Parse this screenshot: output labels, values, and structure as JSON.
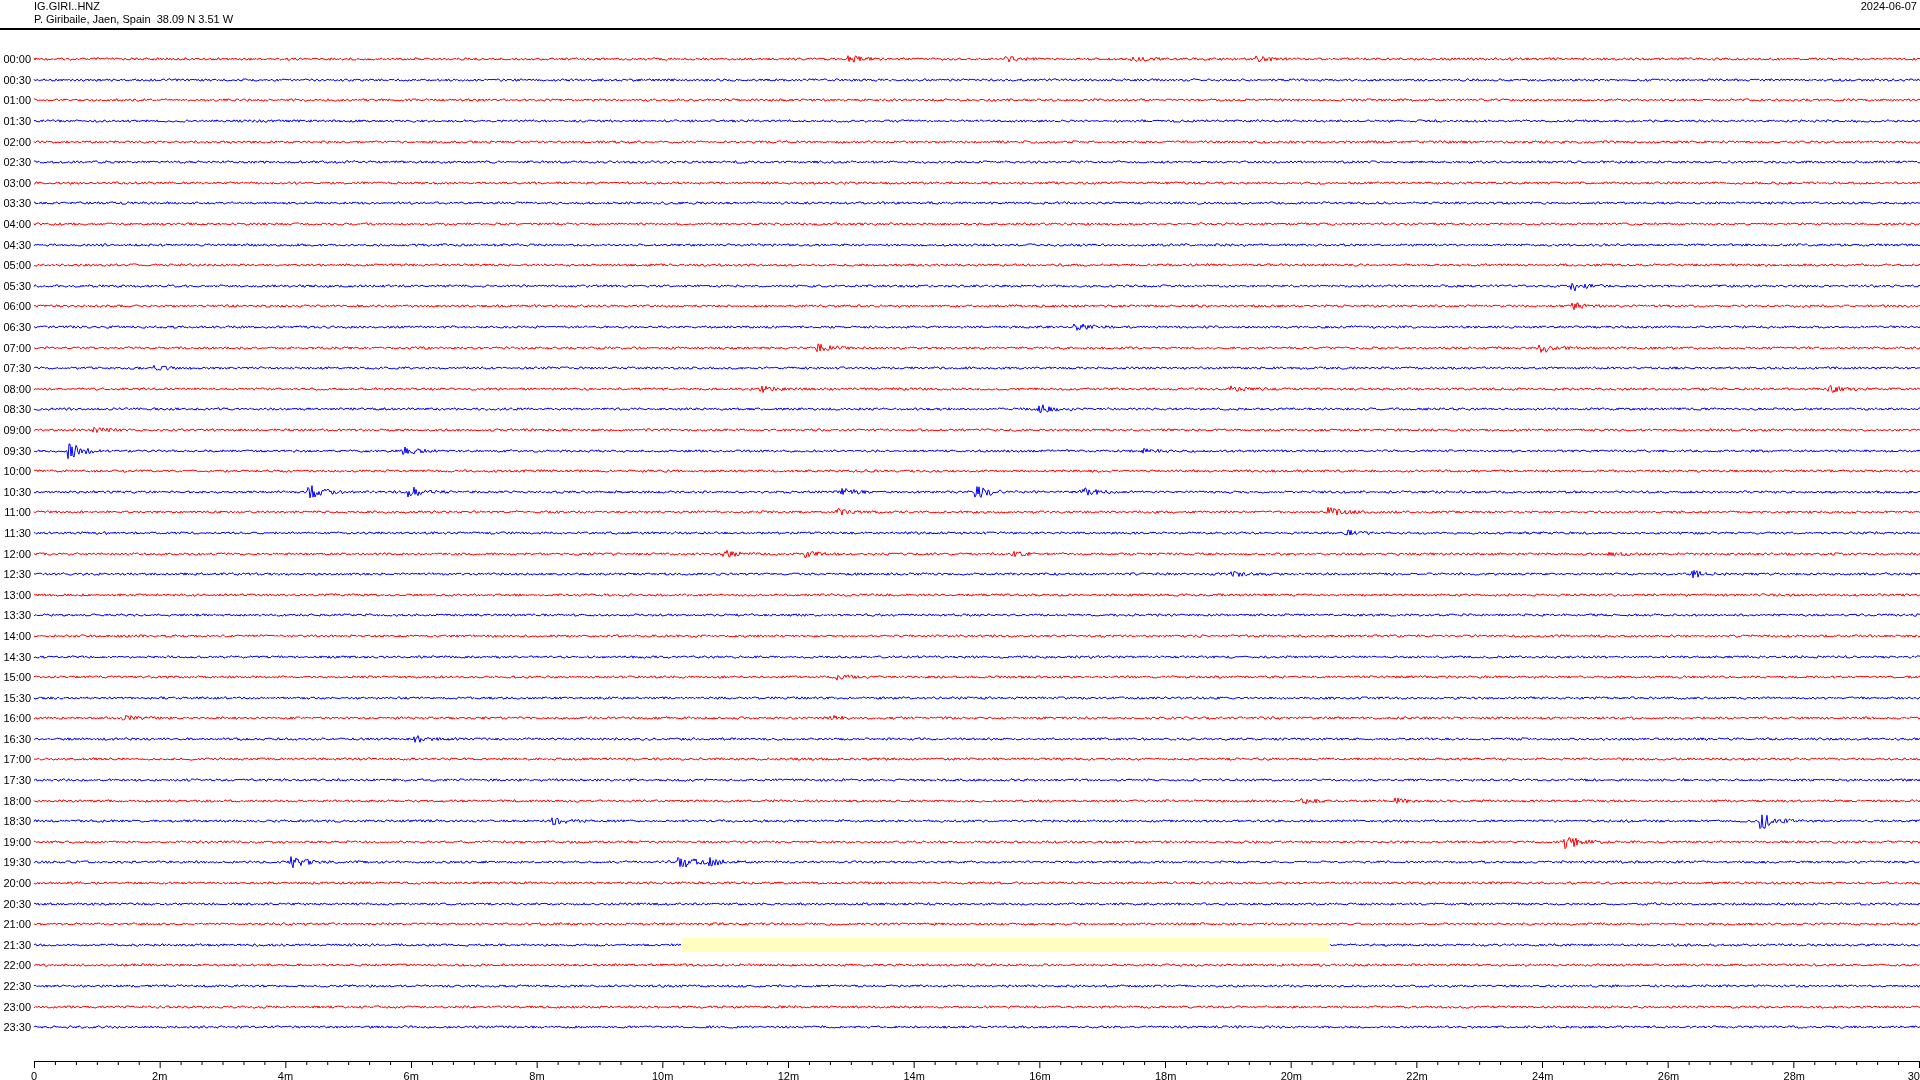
{
  "header": {
    "station": "IG.GIRI..HNZ",
    "location": "P. Giribaile, Jaen, Spain  38.09 N 3.51 W",
    "date": "2024-06-07"
  },
  "rows": [
    {
      "time": "00:00",
      "color": "#ff0000"
    },
    {
      "time": "00:30",
      "color": "#0000ff"
    },
    {
      "time": "01:00",
      "color": "#ff0000"
    },
    {
      "time": "01:30",
      "color": "#0000ff"
    },
    {
      "time": "02:00",
      "color": "#ff0000"
    },
    {
      "time": "02:30",
      "color": "#0000ff"
    },
    {
      "time": "03:00",
      "color": "#ff0000"
    },
    {
      "time": "03:30",
      "color": "#0000ff"
    },
    {
      "time": "04:00",
      "color": "#ff0000"
    },
    {
      "time": "04:30",
      "color": "#0000ff"
    },
    {
      "time": "05:00",
      "color": "#ff0000"
    },
    {
      "time": "05:30",
      "color": "#0000ff"
    },
    {
      "time": "06:00",
      "color": "#ff0000"
    },
    {
      "time": "06:30",
      "color": "#0000ff"
    },
    {
      "time": "07:00",
      "color": "#ff0000"
    },
    {
      "time": "07:30",
      "color": "#0000ff"
    },
    {
      "time": "08:00",
      "color": "#ff0000"
    },
    {
      "time": "08:30",
      "color": "#0000ff"
    },
    {
      "time": "09:00",
      "color": "#ff0000"
    },
    {
      "time": "09:30",
      "color": "#0000ff"
    },
    {
      "time": "10:00",
      "color": "#ff0000"
    },
    {
      "time": "10:30",
      "color": "#0000ff"
    },
    {
      "time": "11:00",
      "color": "#ff0000"
    },
    {
      "time": "11:30",
      "color": "#0000ff"
    },
    {
      "time": "12:00",
      "color": "#ff0000"
    },
    {
      "time": "12:30",
      "color": "#0000ff"
    },
    {
      "time": "13:00",
      "color": "#ff0000"
    },
    {
      "time": "13:30",
      "color": "#0000ff"
    },
    {
      "time": "14:00",
      "color": "#ff0000"
    },
    {
      "time": "14:30",
      "color": "#0000ff"
    },
    {
      "time": "15:00",
      "color": "#ff0000"
    },
    {
      "time": "15:30",
      "color": "#0000ff"
    },
    {
      "time": "16:00",
      "color": "#ff0000"
    },
    {
      "time": "16:30",
      "color": "#0000ff"
    },
    {
      "time": "17:00",
      "color": "#ff0000"
    },
    {
      "time": "17:30",
      "color": "#0000ff"
    },
    {
      "time": "18:00",
      "color": "#ff0000"
    },
    {
      "time": "18:30",
      "color": "#0000ff"
    },
    {
      "time": "19:00",
      "color": "#ff0000"
    },
    {
      "time": "19:30",
      "color": "#0000ff"
    },
    {
      "time": "20:00",
      "color": "#ff0000"
    },
    {
      "time": "20:30",
      "color": "#0000ff"
    },
    {
      "time": "21:00",
      "color": "#ff0000"
    },
    {
      "time": "21:30",
      "color": "#0000ff",
      "data_gap": true
    },
    {
      "time": "22:00",
      "color": "#ff0000"
    },
    {
      "time": "22:30",
      "color": "#0000ff"
    },
    {
      "time": "23:00",
      "color": "#ff0000"
    },
    {
      "time": "23:30",
      "color": "#0000ff"
    }
  ],
  "axis": {
    "ticks": [
      "0",
      "2m",
      "4m",
      "6m",
      "8m",
      "10m",
      "12m",
      "14m",
      "16m",
      "18m",
      "20m",
      "22m",
      "24m",
      "26m",
      "28m",
      "30"
    ]
  }
}
